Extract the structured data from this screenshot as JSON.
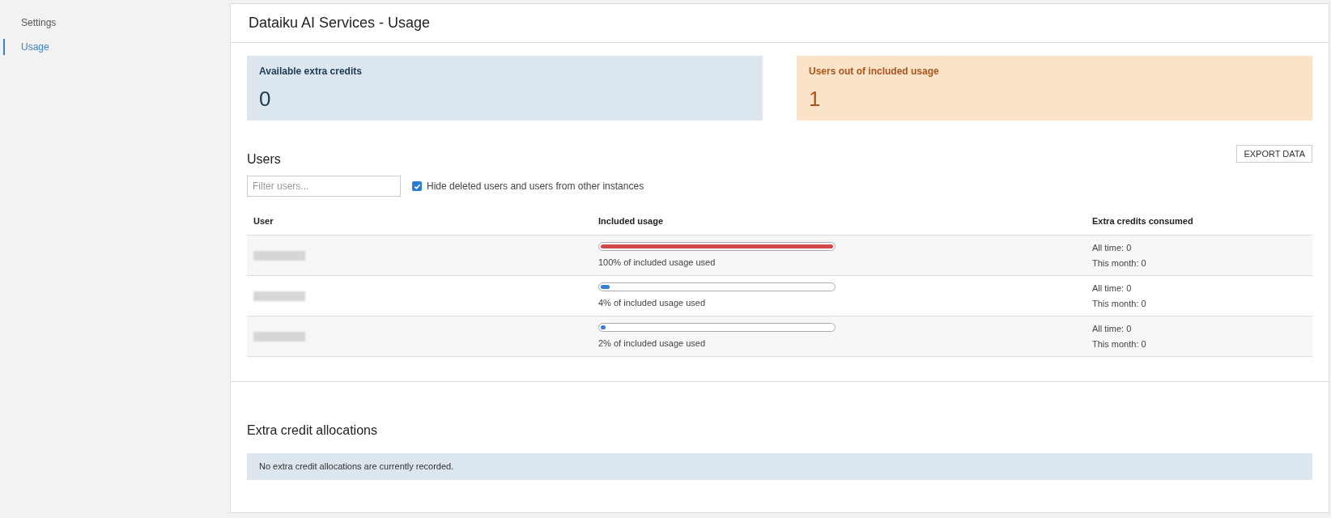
{
  "sidebar": {
    "items": [
      {
        "label": "Settings",
        "selected": false
      },
      {
        "label": "Usage",
        "selected": true
      }
    ]
  },
  "page": {
    "title": "Dataiku AI Services - Usage"
  },
  "cards": [
    {
      "label": "Available extra credits",
      "value": "0",
      "kind": "info"
    },
    {
      "label": "Users out of included usage",
      "value": "1",
      "kind": "warning"
    }
  ],
  "users": {
    "title": "Users",
    "export_button": "EXPORT DATA",
    "filter": {
      "placeholder": "Filter users..."
    },
    "hide_deleted": {
      "label": "Hide deleted users and users from other instances",
      "checked": true
    },
    "columns": [
      "User",
      "Included usage",
      "Extra credits consumed"
    ],
    "rows": [
      {
        "level": 1,
        "usage": "100% of included usage used",
        "all_time": "All time: 0",
        "this_month": "This month: 0"
      },
      {
        "level": 0.04,
        "usage": "4% of included usage used",
        "all_time": "All time: 0",
        "this_month": "This month: 0"
      },
      {
        "level": 0.02,
        "usage": "2% of included usage used",
        "all_time": "All time: 0",
        "this_month": "This month: 0"
      }
    ]
  },
  "allocations": {
    "title": "Extra credit allocations",
    "message": "No extra credit allocations are currently recorded."
  }
}
